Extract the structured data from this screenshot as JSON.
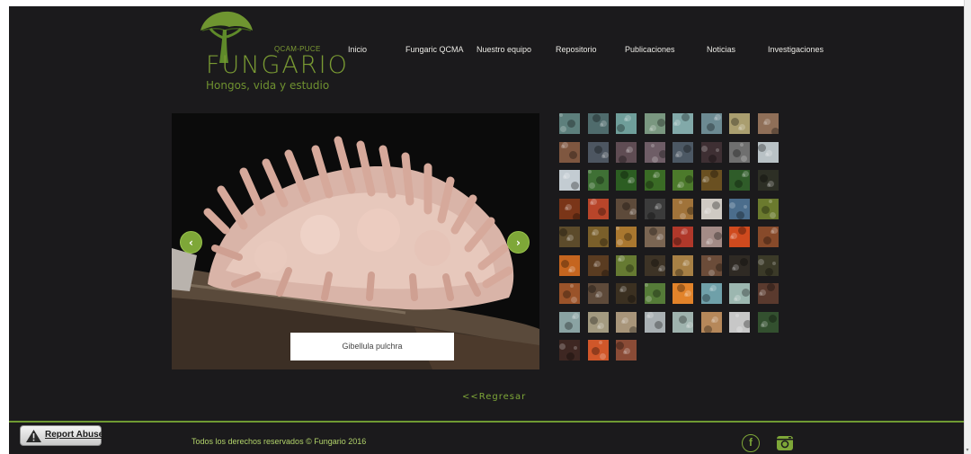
{
  "brand": {
    "org": "QCAM-PUCE",
    "name": "FUNGARIO",
    "tagline": "Hongos, vida y estudio",
    "accent": "#7ea738"
  },
  "nav": {
    "items": [
      {
        "label": "Inicio"
      },
      {
        "label": "Fungaric QCMA"
      },
      {
        "label": "Nuestro equipo"
      },
      {
        "label": "Repositorio"
      },
      {
        "label": "Publicaciones"
      },
      {
        "label": "Noticias"
      },
      {
        "label": "Investigaciones"
      }
    ]
  },
  "slideshow": {
    "caption": "Gibellula pulchra",
    "prev_icon": "chevron-left-icon",
    "next_icon": "chevron-right-icon",
    "prev_glyph": "‹",
    "next_glyph": "›"
  },
  "gallery": {
    "thumbs": [
      "#5d7f7c",
      "#4f6b6c",
      "#6f9e9a",
      "#7a9780",
      "#82a9a9",
      "#6c8a92",
      "#aa9e6f",
      "#8f6f58",
      "#7f5740",
      "#4d5661",
      "#5f4c53",
      "#6e5d66",
      "#4c5864",
      "#3e2f33",
      "#6f6f6f",
      "#b9c2c6",
      "#c3ccd2",
      "#3f7035",
      "#2c5d22",
      "#3a6b25",
      "#4c7a2b",
      "#6a5021",
      "#2f5c29",
      "#2d2f25",
      "#7a3518",
      "#b8452a",
      "#5d4a3a",
      "#3b3b3b",
      "#a0733a",
      "#cfcac3",
      "#4b6d8c",
      "#6b7a2e",
      "#5c4b2b",
      "#7a5f2a",
      "#a9772f",
      "#7a6552",
      "#b0382a",
      "#a38b86",
      "#cf4a1e",
      "#874a2a",
      "#c5651f",
      "#5a3c21",
      "#667a32",
      "#3d3326",
      "#a78045",
      "#6b4c39",
      "#2f2a24",
      "#3b3a28",
      "#9a532a",
      "#5e4a3a",
      "#3b3021",
      "#557b38",
      "#e2832a",
      "#6fa0a9",
      "#9cb7b0",
      "#5a3a2e",
      "#8aa3a3",
      "#a39a80",
      "#a8957a",
      "#a9b0b3",
      "#9fb3ae",
      "#b6885a",
      "#c7c7c7",
      "#33502f",
      "#3e2722",
      "#d0572a",
      "#8a4b36"
    ]
  },
  "footer": {
    "back_link": "<<Regresar",
    "copyright": "Todos los derechos reservados © Fungario 2016",
    "social": [
      {
        "name": "facebook-icon",
        "glyph": "f"
      },
      {
        "name": "instagram-icon"
      }
    ]
  },
  "report_abuse": {
    "label": "Report Abuse"
  }
}
